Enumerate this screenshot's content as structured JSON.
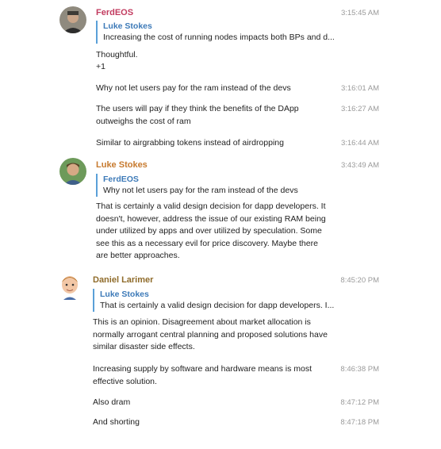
{
  "colors": {
    "ferdeos": "#c23b5f",
    "luke": "#c77a2e",
    "daniel": "#8f6b2a",
    "quote_bar": "#5aa0d8",
    "quote_author": "#3d7ab8",
    "timestamp": "#9a9a9a"
  },
  "messages": {
    "g1": {
      "author": "FerdEOS",
      "time": "3:15:45 AM",
      "quote_author": "Luke Stokes",
      "quote_text": "Increasing the cost of running nodes impacts both BPs and d...",
      "line1": "Thoughtful.",
      "line2": "+1"
    },
    "m2": {
      "text": "Why not let users pay for the ram instead of the devs",
      "time": "3:16:01 AM"
    },
    "m3": {
      "text": "The users will pay if they think the benefits of the DApp outweighs the cost of ram",
      "time": "3:16:27 AM"
    },
    "m4": {
      "text": "Similar to airgrabbing tokens instead of airdropping",
      "time": "3:16:44 AM"
    },
    "g2": {
      "author": "Luke Stokes",
      "time": "3:43:49 AM",
      "quote_author": "FerdEOS",
      "quote_text": "Why not let users pay for the ram instead of the devs",
      "text": "That is certainly a valid design decision for dapp developers. It doesn't, however, address the issue of our existing RAM being under utilized by apps and over utilized by speculation. Some see this as a necessary evil for price discovery. Maybe there are better approaches."
    },
    "g3": {
      "author": "Daniel Larimer",
      "time": "8:45:20 PM",
      "quote_author": "Luke Stokes",
      "quote_text": "That is certainly a valid design decision for dapp developers. I...",
      "text": "This is an opinion. Disagreement about market allocation is normally arrogant central planning and proposed solutions have similar disaster side effects."
    },
    "m6": {
      "text": "Increasing supply by software and hardware means is most effective solution.",
      "time": "8:46:38 PM"
    },
    "m7": {
      "text": "Also dram",
      "time": "8:47:12 PM"
    },
    "m8": {
      "text": "And shorting",
      "time": "8:47:18 PM"
    }
  }
}
